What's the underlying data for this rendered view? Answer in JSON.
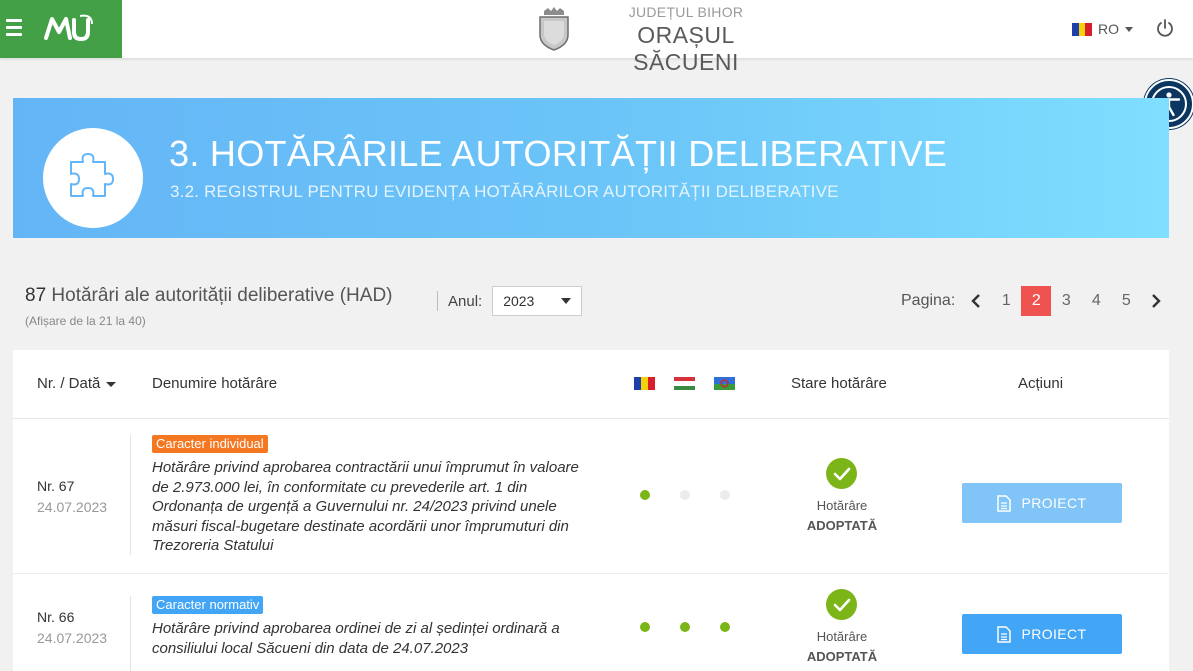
{
  "header": {
    "county": "JUDEȚUL BIHOR",
    "city": "ORAȘUL SĂCUENI",
    "language": "RO",
    "logo_text": "MU"
  },
  "hero": {
    "title": "3. HOTĂRÂRILE AUTORITĂȚII DELIBERATIVE",
    "subtitle": "3.2. REGISTRUL PENTRU EVIDENȚA HOTĂRÂRILOR AUTORITĂȚII DELIBERATIVE",
    "icon": "puzzle-icon"
  },
  "summary": {
    "count": "87",
    "label": " Hotărâri ale autorității deliberative (HAD)",
    "range": "(Afișare de la 21 la 40)"
  },
  "year_filter": {
    "label": "Anul:",
    "value": "2023"
  },
  "pagination": {
    "label": "Pagina:",
    "pages": [
      "1",
      "2",
      "3",
      "4",
      "5"
    ],
    "current": "2"
  },
  "table": {
    "columns": {
      "number_date": "Nr. / Dată",
      "name": "Denumire hotărâre",
      "status": "Stare hotărâre",
      "actions": "Acțiuni"
    },
    "language_flags": [
      "ro-flag",
      "hu-flag",
      "roma-flag"
    ],
    "rows": [
      {
        "number": "Nr. 67",
        "date": "24.07.2023",
        "badge": "Caracter individual",
        "description": "Hotărâre privind aprobarea contractării unui împrumut în valoare de 2.973.000 lei, în conformitate cu prevederile art. 1 din Ordonanța de urgență a Guvernului nr. 24/2023 privind unele măsuri fiscal-bugetare destinate acordării unor împrumuturi din Trezoreria Statului",
        "translations": [
          true,
          false,
          false
        ],
        "status_label": "Hotărâre",
        "status_value": "ADOPTATĂ",
        "action": "PROIECT"
      },
      {
        "number": "Nr. 66",
        "date": "24.07.2023",
        "badge": "Caracter normativ",
        "description": "Hotărâre privind aprobarea ordinei de zi al ședinței ordinară a consiliului local Săcueni din data de 24.07.2023",
        "translations": [
          true,
          true,
          true
        ],
        "status_label": "Hotărâre",
        "status_value": "ADOPTATĂ",
        "action": "PROIECT"
      }
    ]
  },
  "colors": {
    "brand_green": "#43a047",
    "badge_individual": "#f47721",
    "badge_normativ": "#42a5f5",
    "active_page": "#ef5350",
    "success": "#7cb518",
    "button_light": "#81c4f7",
    "button": "#42a5f5"
  }
}
